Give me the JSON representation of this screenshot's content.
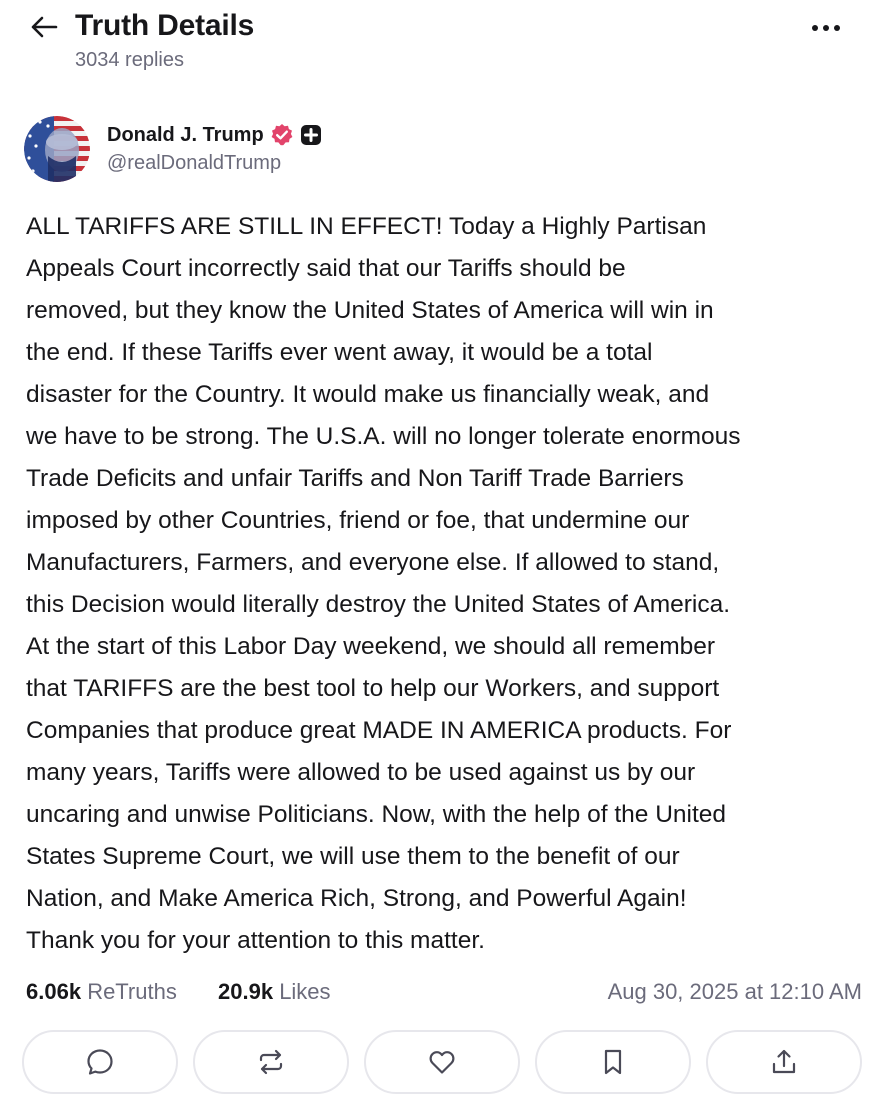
{
  "header": {
    "title": "Truth Details",
    "reply_count": "3034 replies"
  },
  "author": {
    "display_name": "Donald J. Trump",
    "handle": "@realDonaldTrump"
  },
  "post": {
    "lines": [
      "ALL TARIFFS ARE STILL IN EFFECT! Today a Highly Partisan",
      "Appeals Court incorrectly said that our Tariffs should be",
      "removed, but they know the United States of America will win in",
      "the end. If these Tariffs ever went away, it would be a total",
      "disaster for the Country. It would make us financially weak, and",
      "we have to be strong. The U.S.A. will no longer tolerate enormous",
      "Trade Deficits and unfair Tariffs and Non Tariff Trade Barriers",
      "imposed by other Countries, friend or foe, that undermine our",
      "Manufacturers, Farmers, and everyone else. If allowed to stand,",
      "this Decision would literally destroy the United States of America.",
      "At the start of this Labor Day weekend, we should all remember",
      "that TARIFFS are the best tool to help our Workers, and support",
      "Companies that produce great MADE IN AMERICA products. For",
      "many years, Tariffs were allowed to be used against us by our",
      "uncaring and unwise Politicians. Now, with the help of the United",
      "States Supreme Court, we will use them to the benefit of our",
      "Nation, and Make America Rich, Strong, and Powerful Again!",
      "Thank you for your attention to this matter."
    ]
  },
  "stats": {
    "retruths_count": "6.06k",
    "retruths_label": "ReTruths",
    "likes_count": "20.9k",
    "likes_label": "Likes",
    "timestamp": "Aug 30, 2025 at 12:10 AM"
  },
  "actions": [
    {
      "icon": "reply-icon"
    },
    {
      "icon": "retruth-icon"
    },
    {
      "icon": "heart-icon"
    },
    {
      "icon": "bookmark-icon"
    },
    {
      "icon": "share-icon"
    }
  ],
  "colors": {
    "text_primary": "#17171a",
    "text_secondary": "#6b6b7b",
    "verified_badge": "#e2446b",
    "button_border": "#e7e7ec"
  }
}
